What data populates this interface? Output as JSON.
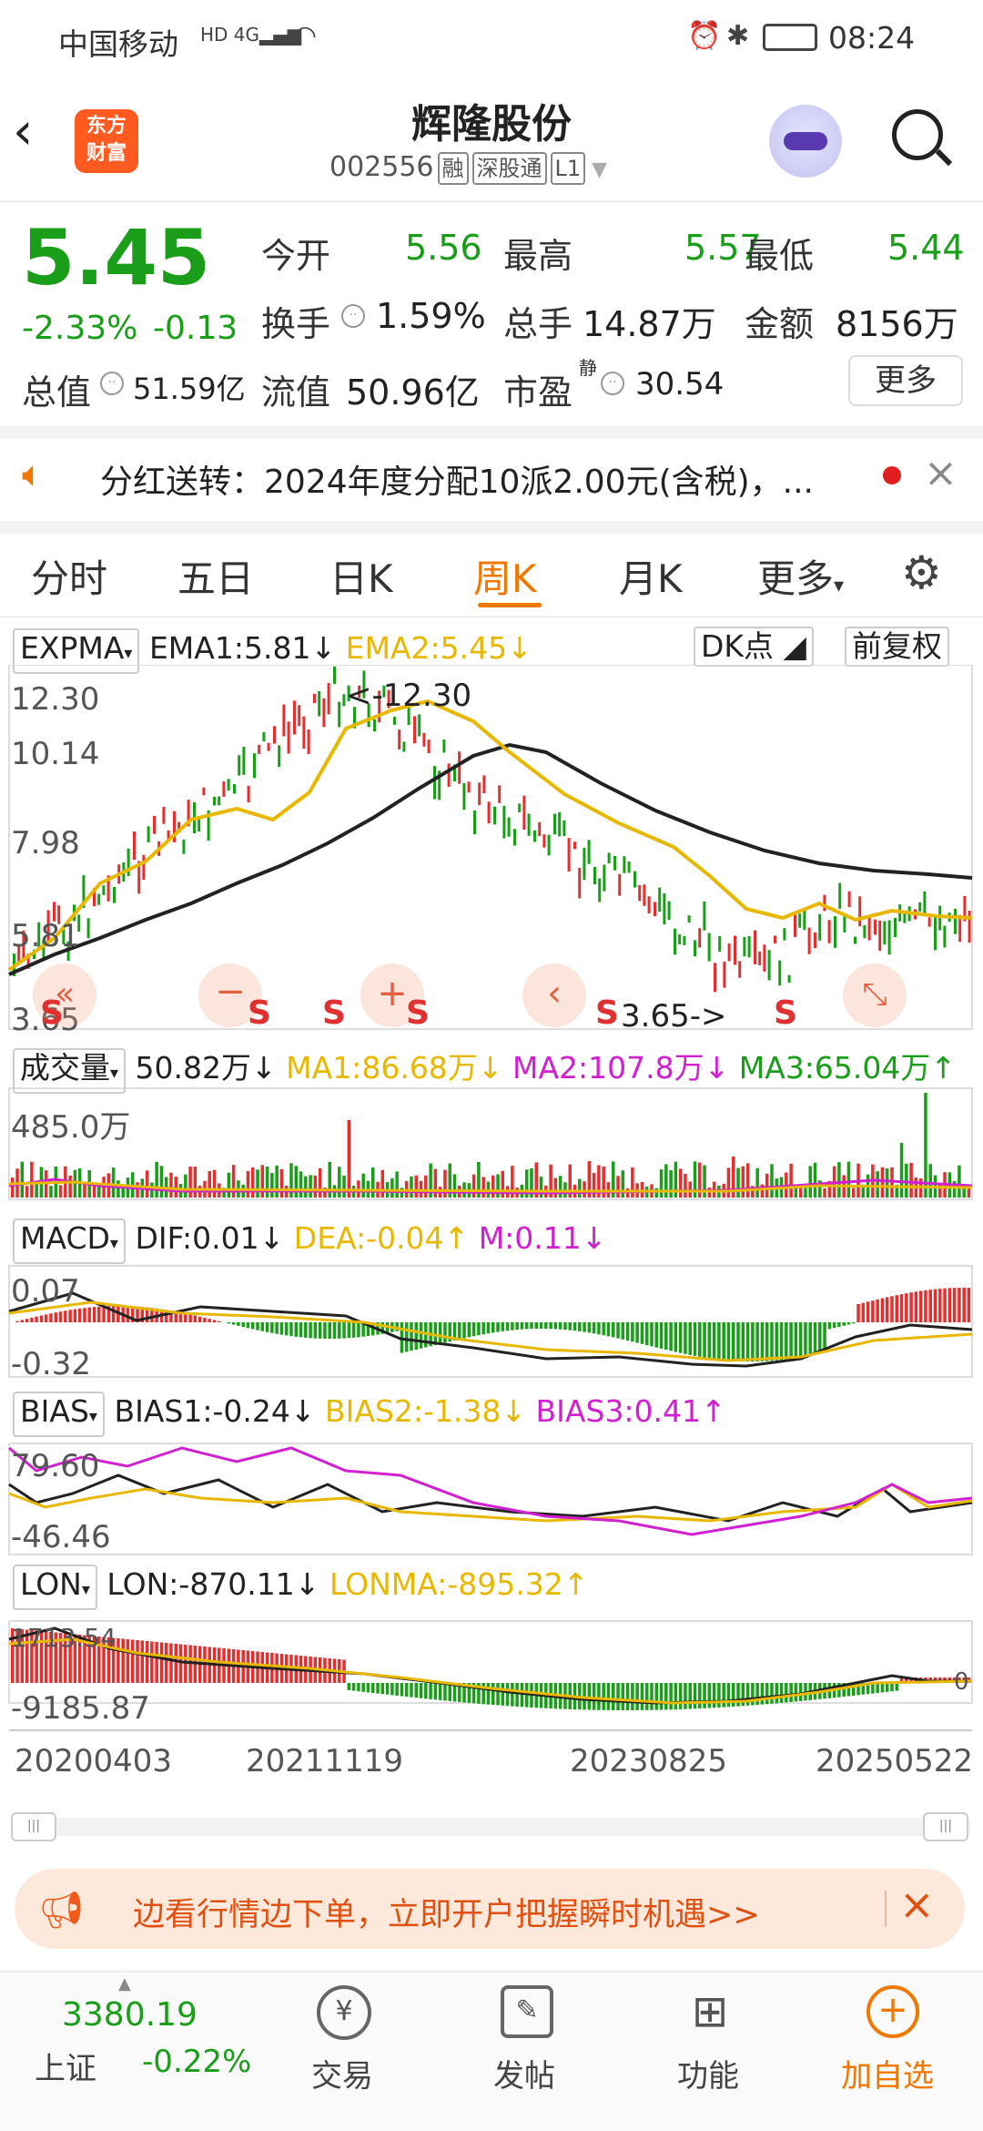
{
  "status_bar": {
    "carrier": "中国移动",
    "net": "4G",
    "time": "08:24"
  },
  "header": {
    "logo_top": "东方",
    "logo_bottom": "财富",
    "title": "辉隆股份",
    "code": "002556",
    "tags": [
      "融",
      "深股通",
      "L1"
    ]
  },
  "quote": {
    "price": "5.45",
    "change_pct": "-2.33%",
    "change": "-0.13",
    "open_label": "今开",
    "open": "5.56",
    "high_label": "最高",
    "high": "5.57",
    "low_label": "最低",
    "low": "5.44",
    "turnover_label": "换手",
    "turnover": "1.59%",
    "volume_label": "总手",
    "volume": "14.87万",
    "amount_label": "金额",
    "amount": "8156万",
    "mktcap_label": "总值",
    "mktcap": "51.59亿",
    "float_label": "流值",
    "float_cap": "50.96亿",
    "pe_label": "市盈",
    "pe_sup": "静",
    "pe": "30.54",
    "more": "更多"
  },
  "notice": {
    "text": "分红送转：2024年度分配10派2.00元(含税)，..."
  },
  "tabs": [
    "分时",
    "五日",
    "日K",
    "周K",
    "月K",
    "更多"
  ],
  "active_tab": "周K",
  "kline": {
    "indicator": "EXPMA",
    "ema1": "EMA1:5.81↓",
    "ema2": "EMA2:5.45↓",
    "dk": "DK点",
    "adjust": "前复权",
    "y_labels": [
      "12.30",
      "10.14",
      "7.98",
      "5.81",
      "3.65"
    ],
    "high_marker": "<-12.30",
    "low_marker": "3.65->",
    "s_marks": [
      "S",
      "S",
      "S",
      "S",
      "S",
      "S"
    ]
  },
  "volume": {
    "indicator": "成交量",
    "v": "50.82万↓",
    "ma1": "MA1:86.68万↓",
    "ma2": "MA2:107.8万↓",
    "ma3": "MA3:65.04万↑",
    "y_top": "485.0万"
  },
  "macd": {
    "indicator": "MACD",
    "dif": "DIF:0.01↓",
    "dea": "DEA:-0.04↑",
    "m": "M:0.11↓",
    "y_top": "0.07",
    "y_bottom": "-0.32"
  },
  "bias": {
    "indicator": "BIAS",
    "b1": "BIAS1:-0.24↓",
    "b2": "BIAS2:-1.38↓",
    "b3": "BIAS3:0.41↑",
    "y_top": "79.60",
    "y_bottom": "-46.46"
  },
  "lon": {
    "indicator": "LON",
    "lon": "LON:-870.11↓",
    "lonma": "LONMA:-895.32↑",
    "y_top": "1713.54",
    "y_bottom": "-9185.87",
    "y_right": "0"
  },
  "dates": [
    "20200403",
    "20211119",
    "20230825",
    "20250522"
  ],
  "banner": {
    "text": "边看行情边下单，立即开户把握瞬时机遇>>"
  },
  "bottom_nav": {
    "index_value": "3380.19",
    "index_name": "上证",
    "index_change": "-0.22%",
    "items": [
      "交易",
      "发帖",
      "功能",
      "加自选"
    ]
  }
}
